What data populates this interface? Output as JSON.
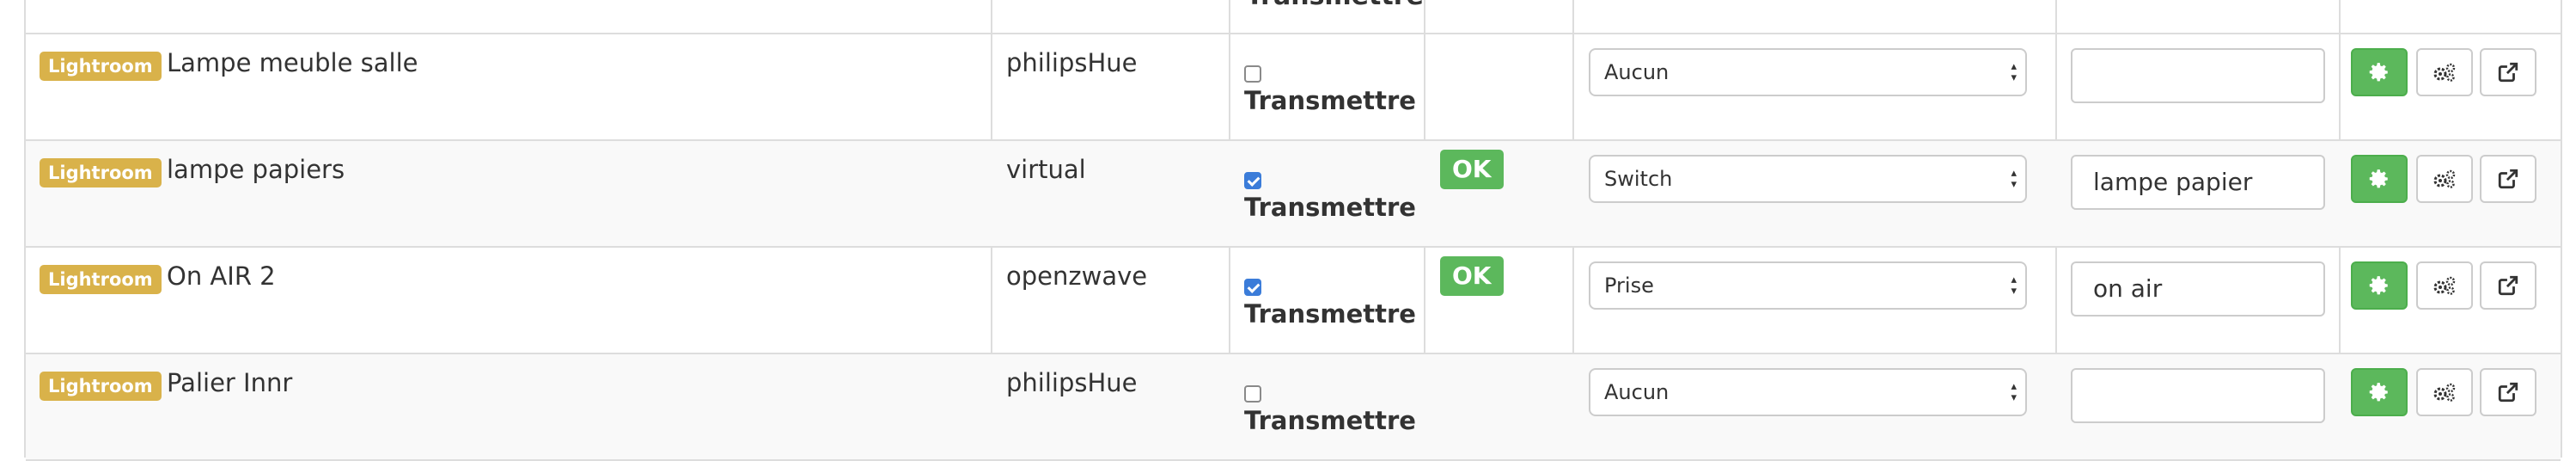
{
  "header": {
    "partial_label": "Transmettre"
  },
  "rows": [
    {
      "room": "Lightroom",
      "name": "Lampe meuble salle",
      "plugin": "philipsHue",
      "checked": false,
      "checkbox_label": "Transmettre",
      "status": "",
      "type": "Aucun",
      "alias": ""
    },
    {
      "room": "Lightroom",
      "name": "lampe papiers",
      "plugin": "virtual",
      "checked": true,
      "checkbox_label": "Transmettre",
      "status": "OK",
      "type": "Switch",
      "alias": "lampe papier"
    },
    {
      "room": "Lightroom",
      "name": "On AIR 2",
      "plugin": "openzwave",
      "checked": true,
      "checkbox_label": "Transmettre",
      "status": "OK",
      "type": "Prise",
      "alias": "on air"
    },
    {
      "room": "Lightroom",
      "name": "Palier Innr",
      "plugin": "philipsHue",
      "checked": false,
      "checkbox_label": "Transmettre",
      "status": "",
      "type": "Aucun",
      "alias": ""
    }
  ],
  "icons": {
    "configure": "gear-icon",
    "advanced": "gears-icon",
    "open": "external-link-icon"
  },
  "colors": {
    "badge": "#d9b24a",
    "ok": "#5cb85c",
    "checkbox_on": "#3b7cd9"
  }
}
